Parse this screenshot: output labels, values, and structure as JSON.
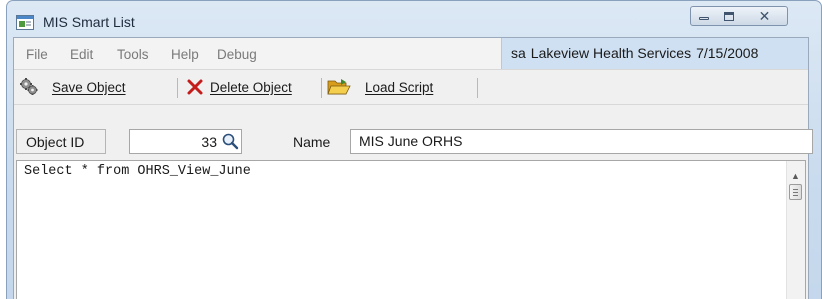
{
  "window": {
    "title": "MIS Smart List",
    "close_glyph": "✕"
  },
  "menu": {
    "items": [
      "File",
      "Edit",
      "Tools",
      "Help",
      "Debug"
    ]
  },
  "status": {
    "user": "sa",
    "company": "Lakeview Health Services",
    "date": "7/15/2008"
  },
  "toolbar": {
    "save_label": "Save Object",
    "delete_label": "Delete Object",
    "load_label": "Load Script"
  },
  "form": {
    "object_id_label": "Object ID",
    "object_id_value": "33",
    "name_label": "Name",
    "name_value": "MIS June ORHS"
  },
  "editor": {
    "script_text": "Select * from OHRS_View_June"
  },
  "colors": {
    "banner_bg": "#cfe0f3",
    "delete_x": "#c41b1b",
    "folder_yellow": "#e8b22a"
  },
  "icons": {
    "app": "app-window-icon",
    "save": "gears-icon",
    "delete": "red-x-icon",
    "load": "open-folder-icon",
    "lookup": "magnifier-icon"
  }
}
